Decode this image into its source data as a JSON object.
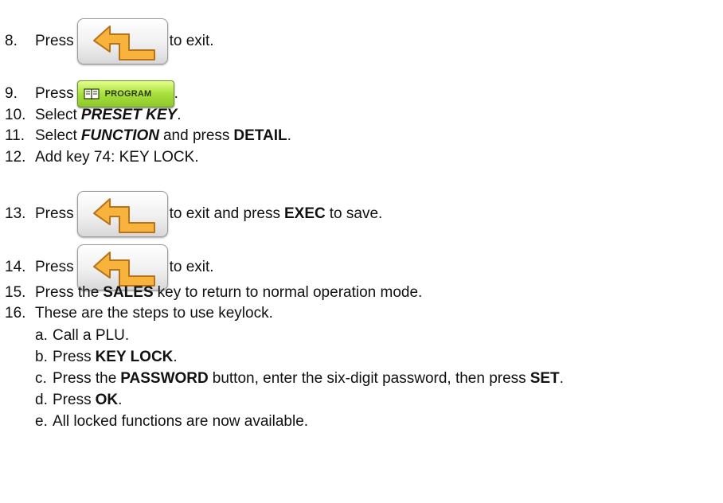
{
  "steps": [
    {
      "num": "8.",
      "pre": "Press",
      "post": "to exit."
    },
    {
      "num": "9.",
      "pre": "Press",
      "post": ".",
      "button_label": "PROGRAM"
    },
    {
      "num": "10.",
      "pre": "Select",
      "bold_italic": "PRESET KEY",
      "post": "."
    },
    {
      "num": "11.",
      "pre": "Select",
      "bold_italic": "FUNCTION",
      "mid": "and press",
      "bold": "DETAIL",
      "post": "."
    },
    {
      "num": "12.",
      "text": "Add key 74: KEY LOCK."
    },
    {
      "num": "13.",
      "pre": "Press",
      "mid": "to exit and press",
      "bold": "EXEC",
      "post": "to save."
    },
    {
      "num": "14.",
      "pre": "Press",
      "post": "to exit."
    },
    {
      "num": "15.",
      "pre": "Press the",
      "bold": "SALES",
      "post": "key to return to normal operation mode."
    },
    {
      "num": "16.",
      "text": "These are the steps to use keylock."
    }
  ],
  "substeps": [
    {
      "num": "a.",
      "text": "Call a PLU."
    },
    {
      "num": "b.",
      "pre": "Press",
      "bold": "KEY LOCK",
      "post": "."
    },
    {
      "num": "c.",
      "pre": "Press the",
      "bold": "PASSWORD",
      "mid": "button, enter the six-digit password, then press",
      "bold2": "SET",
      "post": "."
    },
    {
      "num": "d.",
      "pre": "Press",
      "bold": "OK",
      "post": "."
    },
    {
      "num": "e.",
      "text": "All locked functions are now available."
    }
  ],
  "icons": {
    "back": "back-arrow-icon",
    "program": "book-icon"
  },
  "colors": {
    "arrow_fill": "#f7b33b",
    "arrow_stroke": "#b8731a",
    "program_green": "#a9e03d"
  }
}
